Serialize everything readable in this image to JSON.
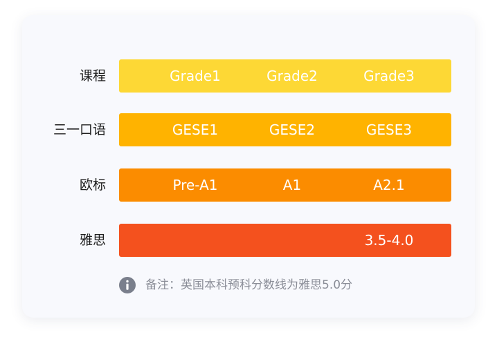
{
  "rows": [
    {
      "label": "课程",
      "color": "#fdd835",
      "cells": [
        "Grade1",
        "Grade2",
        "Grade3"
      ]
    },
    {
      "label": "三一口语",
      "color": "#ffb300",
      "cells": [
        "GESE1",
        "GESE2",
        "GESE3"
      ]
    },
    {
      "label": "欧标",
      "color": "#fb8c00",
      "cells": [
        "Pre-A1",
        "A1",
        "A2.1"
      ]
    },
    {
      "label": "雅思",
      "color": "#f4511e",
      "cells": [
        "",
        "",
        "3.5-4.0"
      ]
    }
  ],
  "note": {
    "icon": "info-icon",
    "icon_color": "#7a7f8c",
    "text": "备注：英国本科预科分数线为雅思5.0分"
  }
}
